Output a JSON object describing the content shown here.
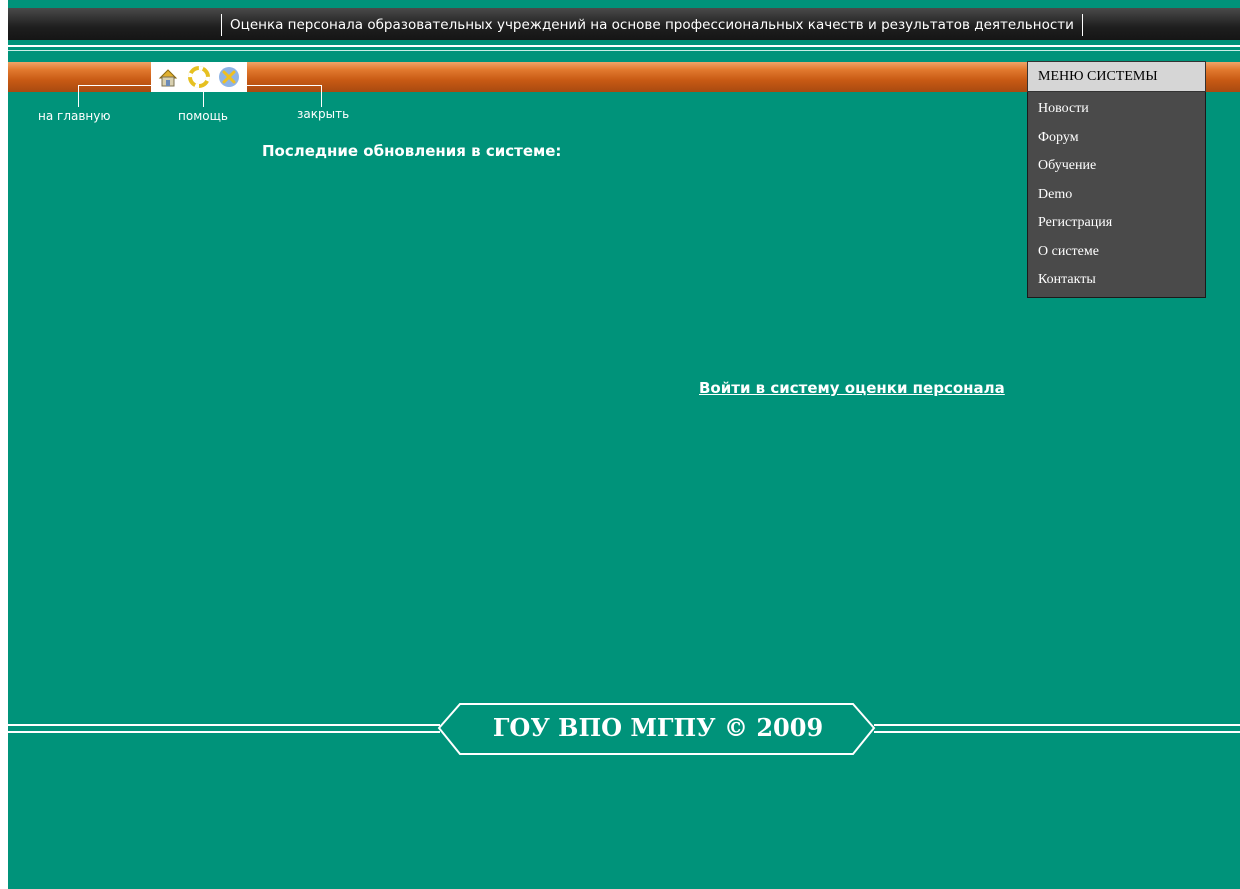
{
  "header": {
    "title": "Оценка персонала образовательных учреждений на основе профессиональных качеств и результатов деятельности"
  },
  "toolbar": {
    "home_label": "на главную",
    "help_label": "помощь",
    "close_label": "закрыть",
    "icons": [
      "home-icon",
      "help-icon",
      "close-icon"
    ]
  },
  "main": {
    "updates_title": "Последние обновления в системе:",
    "login_link": "Войти в систему оценки персонала"
  },
  "system_menu": {
    "header": "МЕНЮ СИСТЕМЫ",
    "items": [
      "Новости",
      "Форум",
      "Обучение",
      "Demo",
      "Регистрация",
      "О системе",
      "Контакты"
    ]
  },
  "footer": {
    "text": "ГОУ ВПО МГПУ © 2009"
  },
  "colors": {
    "background": "#00937a",
    "title_bar": "#1e1e1e",
    "orange_bar": "#e27a2f",
    "menu_header": "#d6d6d6",
    "menu_body": "#4a4a4a",
    "text": "#ffffff"
  }
}
